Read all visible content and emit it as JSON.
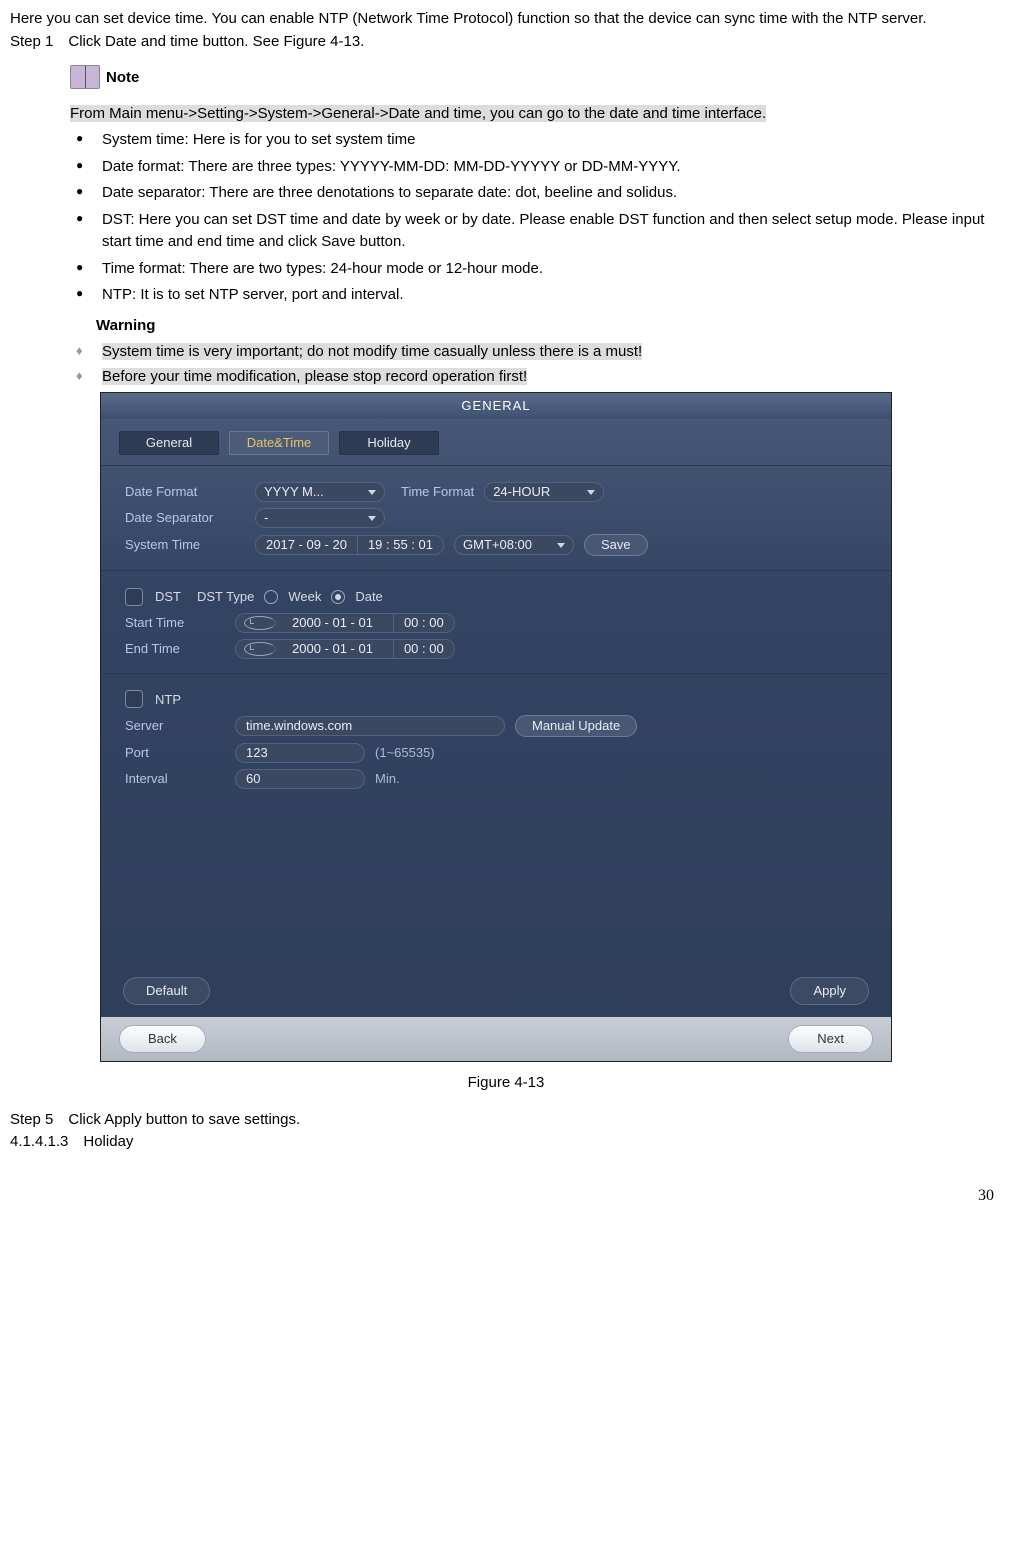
{
  "intro": "Here you can set device time. You can enable NTP (Network Time Protocol) function so that the device can sync time with the NTP server.",
  "step1": "Step 1 Click Date and time button. See Figure 4-13.",
  "note_label": "Note",
  "note_body": "From Main menu->Setting->System->General->Date and time, you can go to the date and time interface.",
  "bullets": [
    "System time: Here is for you to set system time",
    "Date format: There are three types: YYYYY-MM-DD: MM-DD-YYYYY or DD-MM-YYYY.",
    "Date separator: There are three denotations to separate date: dot, beeline and solidus.",
    "DST: Here you can set DST time and date by week or by date. Please enable DST function and then select setup mode. Please input start time and end time and click Save button.",
    "Time format: There are two types: 24-hour mode or 12-hour mode.",
    "NTP: It is to set NTP server, port and interval."
  ],
  "warning_label": "Warning",
  "warnings": [
    "System time is very important; do not modify time casually unless there is a must!",
    "Before your time modification, please stop record operation first!"
  ],
  "figure_caption": "Figure 4-13",
  "step5": "Step 5 Click Apply button to save settings.",
  "section_num": "4.1.4.1.3 Holiday",
  "page_number": "30",
  "win": {
    "title": "GENERAL",
    "tabs": {
      "general": "General",
      "datetime": "Date&Time",
      "holiday": "Holiday"
    },
    "labels": {
      "date_format": "Date Format",
      "time_format": "Time Format",
      "date_separator": "Date Separator",
      "system_time": "System Time",
      "dst": "DST",
      "dst_type": "DST Type",
      "week": "Week",
      "date": "Date",
      "start_time": "Start Time",
      "end_time": "End Time",
      "ntp": "NTP",
      "server": "Server",
      "port": "Port",
      "interval": "Interval",
      "port_range": "(1~65535)",
      "min": "Min."
    },
    "values": {
      "date_format": "YYYY M...",
      "time_format": "24-HOUR",
      "date_separator": "-",
      "sys_date": "2017 - 09  - 20",
      "sys_time": "19  : 55   : 01",
      "gmt": "GMT+08:00",
      "dst_date": "2000   - 01 - 01",
      "dst_time": "00  : 00",
      "server": "time.windows.com",
      "port": "123",
      "interval": "60"
    },
    "buttons": {
      "save": "Save",
      "manual_update": "Manual Update",
      "default": "Default",
      "apply": "Apply",
      "back": "Back",
      "next": "Next"
    }
  }
}
